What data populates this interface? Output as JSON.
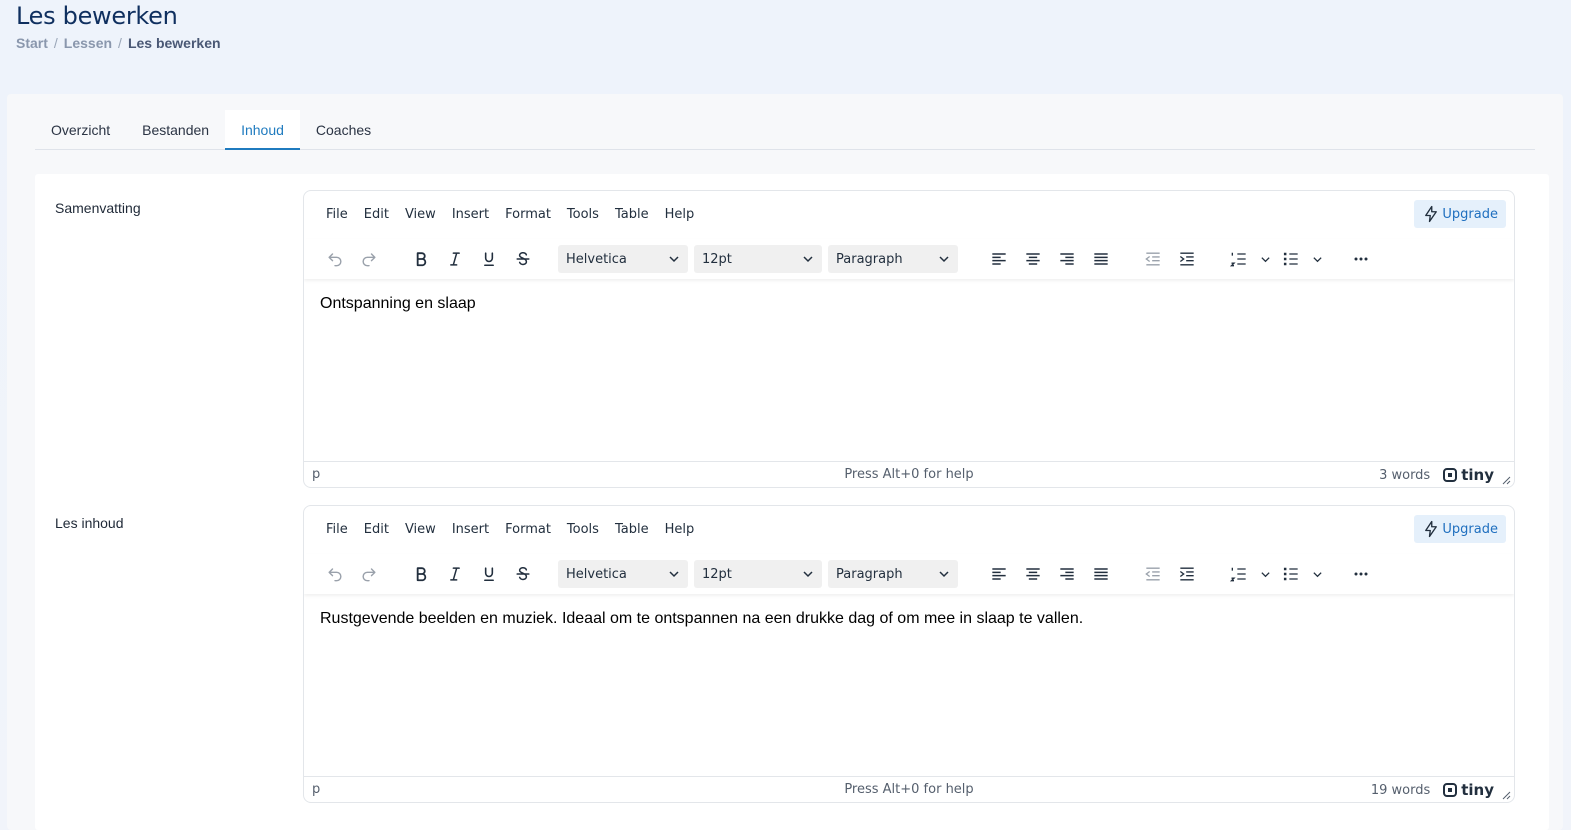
{
  "header": {
    "title": "Les bewerken",
    "breadcrumb": [
      "Start",
      "Lessen",
      "Les bewerken"
    ],
    "separator": "/"
  },
  "tabs": [
    {
      "label": "Overzicht",
      "active": false
    },
    {
      "label": "Bestanden",
      "active": false
    },
    {
      "label": "Inhoud",
      "active": true
    },
    {
      "label": "Coaches",
      "active": false
    }
  ],
  "editor_menu": [
    "File",
    "Edit",
    "View",
    "Insert",
    "Format",
    "Tools",
    "Table",
    "Help"
  ],
  "upgrade_label": "Upgrade",
  "toolbar": {
    "font_family": "Helvetica",
    "font_size": "12pt",
    "block_format": "Paragraph"
  },
  "fields": [
    {
      "label": "Samenvatting",
      "content": "Ontspanning en slaap",
      "path": "p",
      "help": "Press Alt+0 for help",
      "word_count": "3 words",
      "brand": "tiny"
    },
    {
      "label": "Les inhoud",
      "content": "Rustgevende beelden en muziek. Ideaal om te ontspannen na een drukke dag of om mee in slaap te vallen.",
      "path": "p",
      "help": "Press Alt+0 for help",
      "word_count": "19 words",
      "brand": "tiny"
    }
  ],
  "colors": {
    "title": "#0f2f5f",
    "active_tab": "#1f7bbf",
    "upgrade_bg": "#e5f0fb"
  }
}
